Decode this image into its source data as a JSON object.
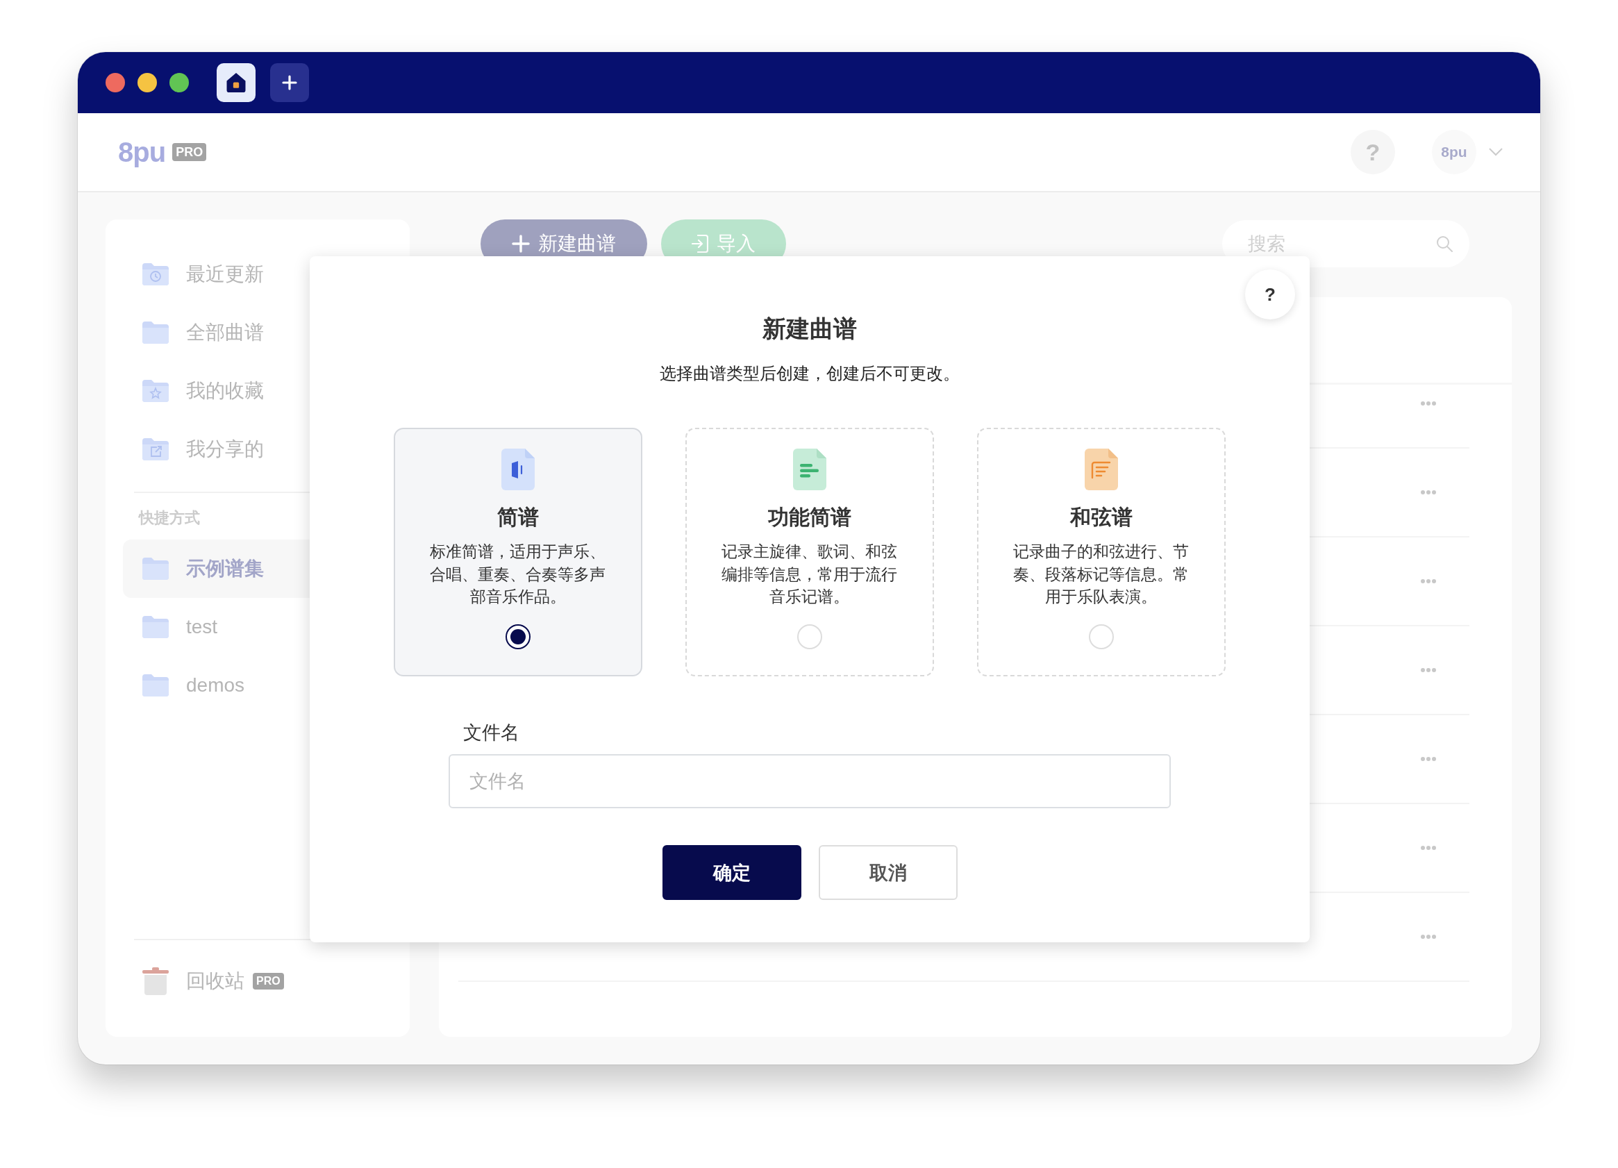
{
  "title_bar": {
    "tabs": [
      {
        "kind": "home",
        "selected": true
      }
    ]
  },
  "header": {
    "logo": "8pu",
    "logo_badge": "PRO",
    "help_label": "?",
    "avatar": "8pu"
  },
  "sidebar": {
    "items": [
      {
        "kind": "clock",
        "label": "最近更新",
        "selected": false
      },
      {
        "kind": "plain",
        "label": "全部曲谱",
        "selected": false
      },
      {
        "kind": "star",
        "label": "我的收藏",
        "selected": false
      },
      {
        "kind": "share",
        "label": "我分享的",
        "selected": false
      }
    ],
    "section_title": "快捷方式",
    "shortcuts": [
      {
        "kind": "plain",
        "label": "示例谱集",
        "selected": true
      },
      {
        "kind": "plain",
        "label": "test",
        "selected": false
      },
      {
        "kind": "plain",
        "label": "demos",
        "selected": false
      }
    ],
    "trash": {
      "label": "回收站",
      "badge": "PRO"
    }
  },
  "toolbar": {
    "buttons": [
      {
        "kind": "new",
        "label": "新建曲谱"
      },
      {
        "kind": "import",
        "label": "导入"
      }
    ],
    "search": {
      "placeholder": "搜索"
    }
  },
  "file_list": {
    "rows": [
      {
        "kind": "file"
      },
      {
        "kind": "file"
      },
      {
        "kind": "file"
      },
      {
        "kind": "file"
      },
      {
        "kind": "file"
      },
      {
        "kind": "file"
      },
      {
        "kind": "file"
      }
    ]
  },
  "dialog": {
    "help_label": "?",
    "title": "新建曲谱",
    "subtitle": "选择曲谱类型后创建，创建后不可更改。",
    "options": [
      {
        "kind": "jianpu",
        "title": "简谱",
        "description": "标准简谱，适用于声乐、合唱、重奏、合奏等多声部音乐作品。",
        "selected": true
      },
      {
        "kind": "function",
        "title": "功能简谱",
        "description": "记录主旋律、歌词、和弦编排等信息，常用于流行音乐记谱。",
        "selected": false
      },
      {
        "kind": "chord",
        "title": "和弦谱",
        "description": "记录曲子的和弦进行、节奏、段落标记等信息。常用于乐队表演。",
        "selected": false
      }
    ],
    "filename": {
      "label": "文件名",
      "placeholder": "文件名"
    },
    "buttons": [
      {
        "kind": "primary",
        "label": "确定"
      },
      {
        "kind": "secondary",
        "label": "取消"
      }
    ]
  }
}
